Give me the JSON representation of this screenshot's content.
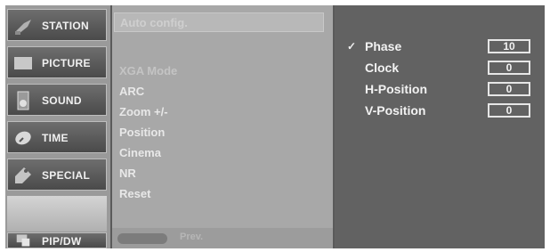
{
  "sidebar": {
    "items": [
      {
        "label": "STATION",
        "icon": "antenna-icon"
      },
      {
        "label": "PICTURE",
        "icon": "picture-icon"
      },
      {
        "label": "SOUND",
        "icon": "speaker-icon"
      },
      {
        "label": "TIME",
        "icon": "clock-icon"
      },
      {
        "label": "SPECIAL",
        "icon": "tag-icon"
      },
      {
        "label": "PIP/DW",
        "icon": "pip-icon"
      }
    ]
  },
  "submenu": {
    "header": "Auto config.",
    "items": [
      "XGA Mode",
      "ARC",
      "Zoom +/-",
      "Position",
      "Cinema",
      "NR",
      "Reset"
    ],
    "footer_label": "Prev."
  },
  "settings": {
    "rows": [
      {
        "label": "Phase",
        "value": "10",
        "selected": true
      },
      {
        "label": "Clock",
        "value": "0",
        "selected": false
      },
      {
        "label": "H-Position",
        "value": "0",
        "selected": false
      },
      {
        "label": "V-Position",
        "value": "0",
        "selected": false
      }
    ],
    "check_mark": "✓"
  },
  "colors": {
    "background": "#5a5a5a",
    "highlight": "#f2f2f2"
  }
}
